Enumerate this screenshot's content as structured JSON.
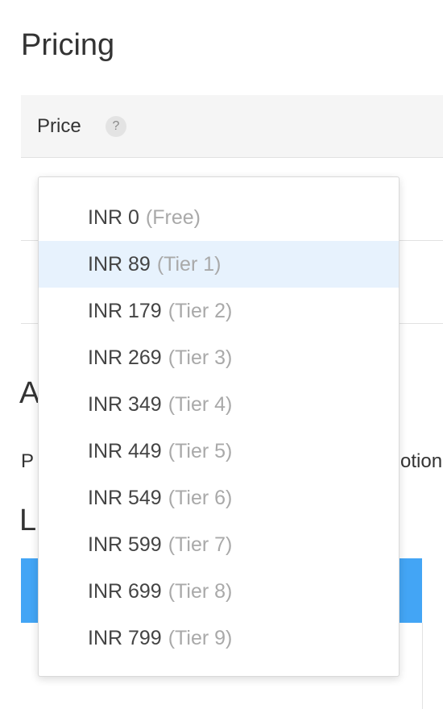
{
  "page": {
    "title": "Pricing"
  },
  "price_section": {
    "label": "Price",
    "help_icon": "question-mark-icon",
    "help_glyph": "?"
  },
  "background": {
    "heading_fragment": "A",
    "line_fragment_left": "P",
    "line_fragment_right": "otion",
    "heading2_fragment": "L"
  },
  "colors": {
    "selected_option_bg": "#e7f2fd",
    "blue_bar": "#43a5f5",
    "tier_text": "#a9a9a9"
  },
  "dropdown": {
    "selected_index": 1,
    "options": [
      {
        "price": "INR 0",
        "tier": "(Free)"
      },
      {
        "price": "INR 89",
        "tier": "(Tier 1)"
      },
      {
        "price": "INR 179",
        "tier": "(Tier 2)"
      },
      {
        "price": "INR 269",
        "tier": "(Tier 3)"
      },
      {
        "price": "INR 349",
        "tier": "(Tier 4)"
      },
      {
        "price": "INR 449",
        "tier": "(Tier 5)"
      },
      {
        "price": "INR 549",
        "tier": "(Tier 6)"
      },
      {
        "price": "INR 599",
        "tier": "(Tier 7)"
      },
      {
        "price": "INR 699",
        "tier": "(Tier 8)"
      },
      {
        "price": "INR 799",
        "tier": "(Tier 9)"
      }
    ]
  }
}
